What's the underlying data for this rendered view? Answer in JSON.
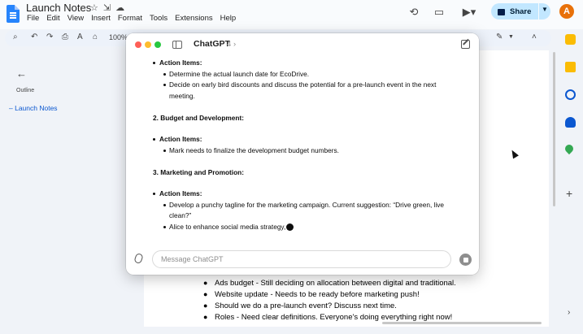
{
  "docs": {
    "title": "Launch Notes",
    "menu": [
      "File",
      "Edit",
      "View",
      "Insert",
      "Format",
      "Tools",
      "Extensions",
      "Help"
    ],
    "share_label": "Share",
    "avatar_letter": "A",
    "zoom": "100%",
    "outline": {
      "heading": "Outline",
      "items": [
        "Launch Notes"
      ]
    },
    "visible_lines": [
      "Ads budget - Still deciding on allocation between digital and traditional.",
      "Website update - Needs to be ready before marketing push!",
      "Should we do a pre-launch event? Discuss next time.",
      "Roles - Need clear definitions. Everyone's doing everything right now!"
    ],
    "colors": {
      "accent": "#0b57d0",
      "share_bg": "#c2e7ff",
      "avatar": "#e8710a"
    }
  },
  "chatgpt": {
    "app_name": "ChatGPT",
    "model_version": "4",
    "model_chevron": "›",
    "input_placeholder": "Message ChatGPT",
    "response": {
      "section1_action_label": "Action Items:",
      "section1_items": [
        "Determine the actual launch date for EcoDrive.",
        "Decide on early bird discounts and discuss the potential for a pre-launch event in the next",
        "meeting."
      ],
      "section2_heading": "2. Budget and Development:",
      "section2_action_label": "Action Items:",
      "section2_items": [
        "Mark needs to finalize the development budget numbers."
      ],
      "section3_heading": "3. Marketing and Promotion:",
      "section3_action_label": "Action Items:",
      "section3_items": [
        "Develop a punchy tagline for the marketing campaign. Current suggestion: “Drive green, live",
        "clean?”",
        "Alice to enhance social media strategy,"
      ]
    }
  }
}
